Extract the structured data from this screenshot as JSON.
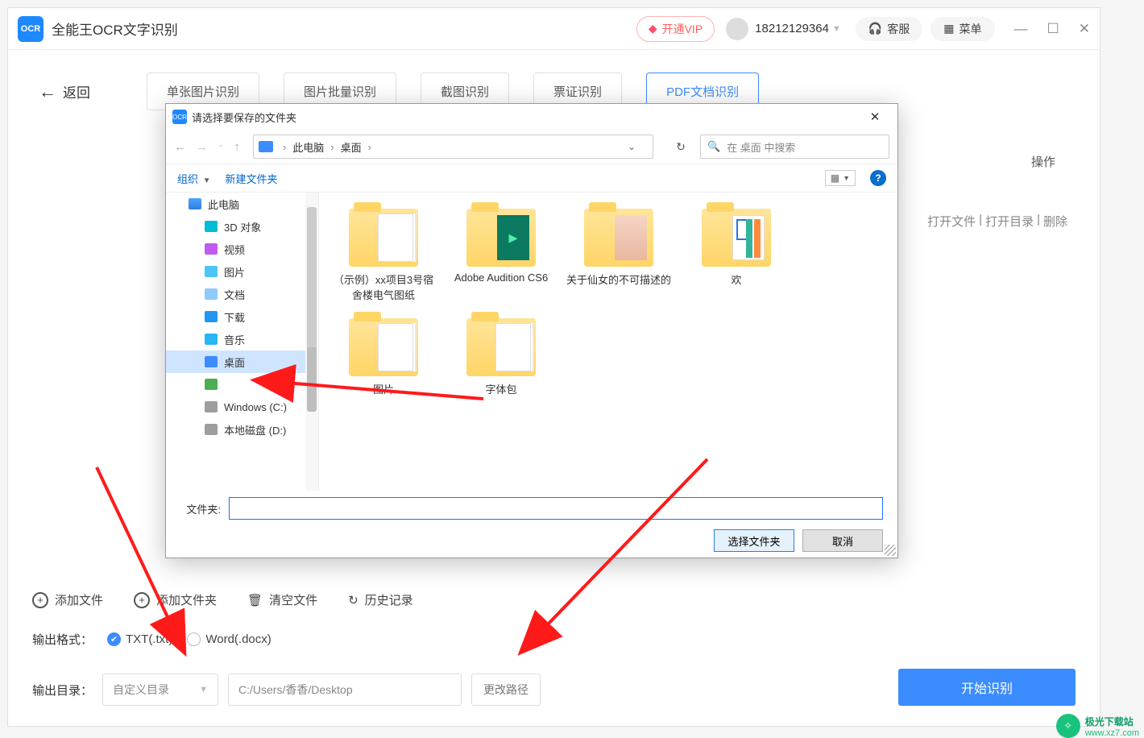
{
  "app": {
    "title": "全能王OCR文字识别",
    "logo_text": "OCR"
  },
  "titlebar": {
    "vip": "开通VIP",
    "user_phone": "18212129364",
    "service": "客服",
    "menu": "菜单"
  },
  "nav": {
    "back": "返回",
    "tabs": [
      "单张图片识别",
      "图片批量识别",
      "截图识别",
      "票证识别",
      "PDF文档识别"
    ],
    "active_index": 4
  },
  "list": {
    "op_header": "操作",
    "actions": [
      "打开文件",
      "打开目录",
      "删除"
    ]
  },
  "toolbar": {
    "add_file": "添加文件",
    "add_folder": "添加文件夹",
    "clear": "清空文件",
    "history": "历史记录"
  },
  "output_format": {
    "label": "输出格式：",
    "options": [
      "TXT(.txt)",
      "Word(.docx)"
    ],
    "selected_index": 0
  },
  "output_dir": {
    "label": "输出目录：",
    "mode": "自定义目录",
    "path": "C:/Users/香香/Desktop",
    "change": "更改路径"
  },
  "start_button": "开始识别",
  "dialog": {
    "title": "请选择要保存的文件夹",
    "breadcrumb": [
      "此电脑",
      "桌面"
    ],
    "search_placeholder": "在 桌面 中搜索",
    "toolbar": {
      "organize": "组织",
      "new_folder": "新建文件夹"
    },
    "tree": [
      {
        "label": "此电脑",
        "icon": "pc"
      },
      {
        "label": "3D 对象",
        "icon": "cube",
        "indent": true
      },
      {
        "label": "视频",
        "icon": "video",
        "indent": true
      },
      {
        "label": "图片",
        "icon": "pic",
        "indent": true
      },
      {
        "label": "文档",
        "icon": "doc",
        "indent": true
      },
      {
        "label": "下载",
        "icon": "dl",
        "indent": true
      },
      {
        "label": "音乐",
        "icon": "music",
        "indent": true
      },
      {
        "label": "桌面",
        "icon": "desk",
        "indent": true,
        "selected": true
      },
      {
        "label": "",
        "icon": "green",
        "indent": true
      },
      {
        "label": "Windows (C:)",
        "icon": "drive",
        "indent": true
      },
      {
        "label": "本地磁盘 (D:)",
        "icon": "drive",
        "indent": true
      }
    ],
    "folders": [
      {
        "name": "（示例）xx项目3号宿舍楼电气图纸",
        "variant": "papers"
      },
      {
        "name": "Adobe Audition CS6",
        "variant": "green"
      },
      {
        "name": "关于仙女的不可描述的",
        "variant": "photo"
      },
      {
        "name": "欢",
        "variant": "pic"
      },
      {
        "name": "图片",
        "variant": "papers"
      },
      {
        "name": "字体包",
        "variant": "papers"
      }
    ],
    "footer": {
      "folder_label": "文件夹:",
      "folder_value": "",
      "select": "选择文件夹",
      "cancel": "取消"
    }
  },
  "watermark": {
    "cn": "极光下载站",
    "url": "www.xz7.com"
  }
}
